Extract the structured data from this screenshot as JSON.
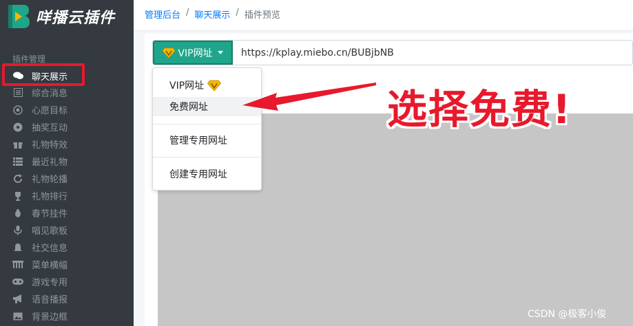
{
  "app": {
    "logo_text": "咩播云插件",
    "logo_letter": "B"
  },
  "sidebar": {
    "header": "插件管理",
    "items": [
      {
        "label": "聊天展示",
        "icon": "comments-icon",
        "active": true
      },
      {
        "label": "综合消息",
        "icon": "list-icon"
      },
      {
        "label": "心愿目标",
        "icon": "target-icon"
      },
      {
        "label": "抽奖互动",
        "icon": "gamepad-icon"
      },
      {
        "label": "礼物特效",
        "icon": "gift-icon"
      },
      {
        "label": "最近礼物",
        "icon": "list-bullets-icon"
      },
      {
        "label": "礼物轮播",
        "icon": "refresh-icon"
      },
      {
        "label": "礼物排行",
        "icon": "trophy-icon"
      },
      {
        "label": "春节挂件",
        "icon": "bug-icon"
      },
      {
        "label": "唱见歌板",
        "icon": "microphone-icon"
      },
      {
        "label": "社交信息",
        "icon": "bell-icon"
      },
      {
        "label": "菜单横幅",
        "icon": "banner-icon"
      },
      {
        "label": "游戏专用",
        "icon": "game-controller-icon"
      },
      {
        "label": "语音播报",
        "icon": "bullhorn-icon"
      },
      {
        "label": "背景边框",
        "icon": "image-icon"
      }
    ]
  },
  "breadcrumb": {
    "home": "管理后台",
    "section": "聊天展示",
    "current": "插件预览"
  },
  "toolbar": {
    "vip_button_label": "VIP网址",
    "url_value": "https://kplay.miebo.cn/BUBjbNB"
  },
  "dropdown": {
    "items": [
      {
        "label": "VIP网址",
        "has_vip_badge": true
      },
      {
        "label": "免费网址",
        "highlighted": true
      },
      {
        "label": "管理专用网址"
      },
      {
        "label": "创建专用网址"
      }
    ]
  },
  "annotation": {
    "text": "选择免费!"
  },
  "watermark": "CSDN @极客小俊",
  "colors": {
    "accent": "#1fa58a",
    "annotation": "#e8192c",
    "sidebar_bg": "#343a40",
    "link": "#007bff",
    "vip_gold": "#f5b800"
  }
}
